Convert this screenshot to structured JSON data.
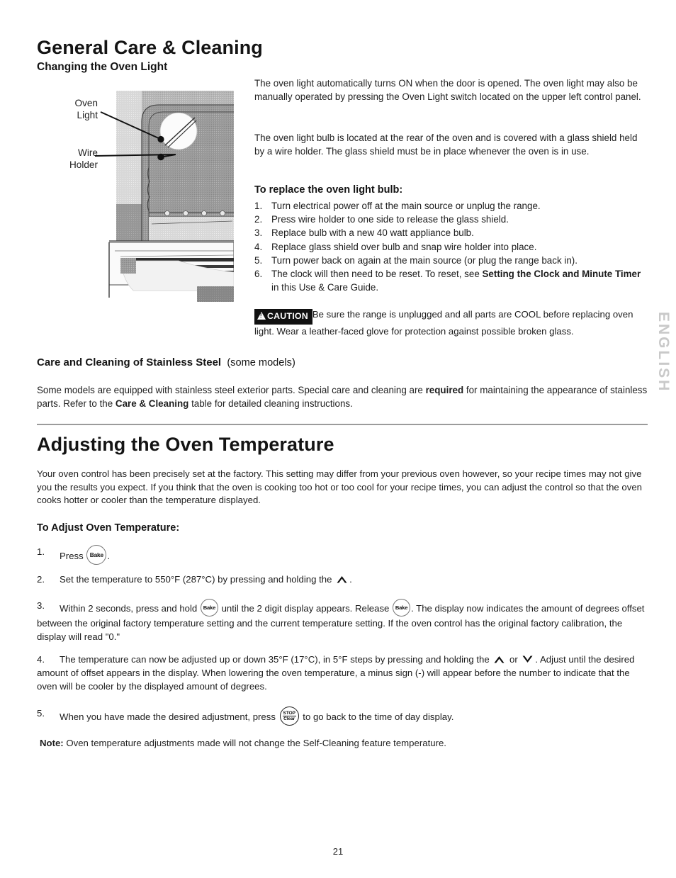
{
  "page": {
    "number": "21",
    "side_tab": "ENGLISH"
  },
  "section_one": {
    "title": "General Care & Cleaning",
    "subtitle": "Changing the Oven Light",
    "figure": {
      "callouts": [
        {
          "name": "oven-light",
          "line1": "Oven",
          "line2": "Light"
        },
        {
          "name": "wire-holder",
          "line1": "Wire",
          "line2": "Holder"
        }
      ]
    },
    "paragraph_1": "The oven light automatically turns ON when the door is opened. The oven light may also be manually operated by pressing the Oven Light switch located on the upper left control panel.",
    "paragraph_2": "The oven light bulb is located at the rear of the oven and is covered with a glass shield held by a wire holder. The glass shield must be in place whenever the oven is in use.",
    "list_heading": "To replace the oven light bulb:",
    "steps": [
      {
        "num": "1.",
        "text": "Turn electrical power off at the main source or unplug the range."
      },
      {
        "num": "2.",
        "text": "Press wire holder to one side to release the glass shield."
      },
      {
        "num": "3.",
        "text": "Replace bulb with a new 40 watt appliance bulb."
      },
      {
        "num": "4.",
        "text": "Replace glass shield over bulb and snap wire holder into place."
      },
      {
        "num": "5.",
        "text": "Turn power back on again at the main source (or plug the range back in)."
      }
    ],
    "step6": {
      "num": "6.",
      "before": "The clock will then need to be reset. To reset, see ",
      "bold": "Setting the Clock and Minute Timer",
      "after": " in this Use & Care Guide."
    },
    "caution": {
      "badge": "CAUTION",
      "text": "Be sure the range is unplugged and all parts are COOL before replacing oven light. Wear a leather-faced glove for protection against possible broken glass."
    }
  },
  "section_stainless": {
    "heading_bold": "Care and Cleaning of Stainless Steel",
    "heading_light": "(some models)",
    "body_before_1": "Some models are equipped with stainless steel exterior parts. Special care and cleaning are ",
    "body_bold_1": "required",
    "body_middle": " for maintaining the appearance of stainless parts. Refer to the ",
    "body_bold_2": "Care & Cleaning",
    "body_after": " table for detailed cleaning instructions."
  },
  "section_two": {
    "title": "Adjusting the Oven Temperature",
    "intro": "Your oven control has been precisely set at the factory. This setting may differ from your previous oven however, so your recipe times may not give you the results you expect. If you think that the oven is cooking too hot or too cool for your recipe times, you can adjust the control so that the oven cooks hotter or cooler than the temperature displayed.",
    "list_heading": "To Adjust Oven Temperature:",
    "steps": [
      {
        "num": "1.",
        "part_a": "Press ",
        "icon": "bake-button-icon",
        "icon_label": "Bake",
        "part_b": "."
      },
      {
        "num": "2.",
        "part_a": "Set the temperature to 550°F (287°C) by pressing and holding the ",
        "icon": "chevron-up-icon",
        "part_b": "."
      },
      {
        "num": "3.",
        "part_a": "Within 2 seconds, press and hold ",
        "icon_label": "Bake",
        "part_b": " until the 2 digit display appears. Release ",
        "icon_label_2": "Bake",
        "part_c": ". The display now indicates the amount of degrees offset between the original factory temperature setting and the current temperature setting. If the oven control has the original factory calibration, the display will read \"0.\""
      },
      {
        "num": "4.",
        "part_a": "The temperature can now be adjusted up or down 35°F (17°C), in 5°F steps by pressing and holding the ",
        "icon": "chevron-up-icon",
        "part_b": " or ",
        "icon_2": "chevron-down-icon",
        "part_c": ". Adjust until the desired amount of offset appears in the display. When lowering the oven temperature, a minus sign (-) will appear before the number to indicate that the oven will be cooler by the displayed amount of degrees."
      },
      {
        "num": "5.",
        "part_a": "When you have made the desired adjustment, press ",
        "icon": "stop-clear-button-icon",
        "icon_label_top": "STOP",
        "icon_label_bottom": "Clear",
        "part_b": " to go back to the time of day display."
      }
    ],
    "note_label": "Note:",
    "note_text": " Oven temperature adjustments made will not change the Self-Cleaning feature temperature."
  }
}
